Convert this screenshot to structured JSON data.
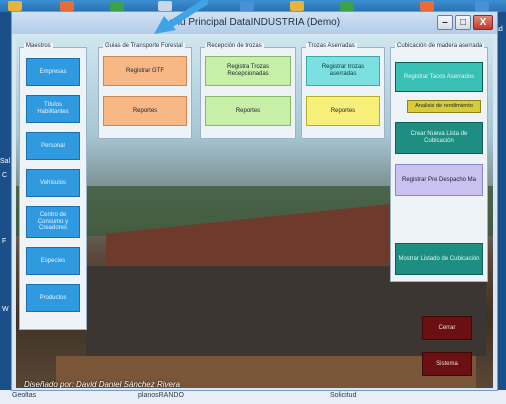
{
  "window": {
    "title": "enu Principal DataINDUSTRIA (Demo)",
    "minimize_icon": "minimize-icon",
    "maximize_icon": "maximize-icon",
    "close_label": "X"
  },
  "groups": {
    "maestros": {
      "title": "Maestros",
      "buttons": [
        "Empresas",
        "Títulos Habilitantes",
        "Personal",
        "Vehículos",
        "Centro de Consumo y Creadores",
        "Especies",
        "Productos"
      ]
    },
    "guias": {
      "title": "Guias de Transporte Forestal",
      "register": "Registrar GTF",
      "reports": "Reportes"
    },
    "recepcion": {
      "title": "Recepción de trozas",
      "register": "Registra Trozas Recepcionadas",
      "reports": "Reportes"
    },
    "trozas": {
      "title": "Trozas Aserradas",
      "register": "Registrar trozas aserradas",
      "reports": "Reportes"
    },
    "cubicacion": {
      "title": "Cubicación de madera aserrada",
      "register": "Registrar Tacos Aserrados",
      "analysis": "Analisis de rendimiento",
      "create_list": "Crear Nueva Lista de Cubicación",
      "pre_dispatch": "Registrar Pre Despacho Ma",
      "show_list": "Mostrar Listado de Cubicación"
    }
  },
  "actions": {
    "close": "Cerrar",
    "system": "Sistema"
  },
  "footer": {
    "credit": "Diseñado por: David Daniel Sánchez Rivera"
  },
  "desktop": {
    "left_labels": [
      "Sal",
      "C",
      "F",
      "W"
    ],
    "right_label": "ad",
    "bottom_labels": [
      "Geoltas",
      "planosRANDO",
      "Solicitud"
    ]
  },
  "colors": {
    "accent_blue": "#2f9ae0",
    "close_red": "#c0392b",
    "maroon": "#6a0f12"
  }
}
